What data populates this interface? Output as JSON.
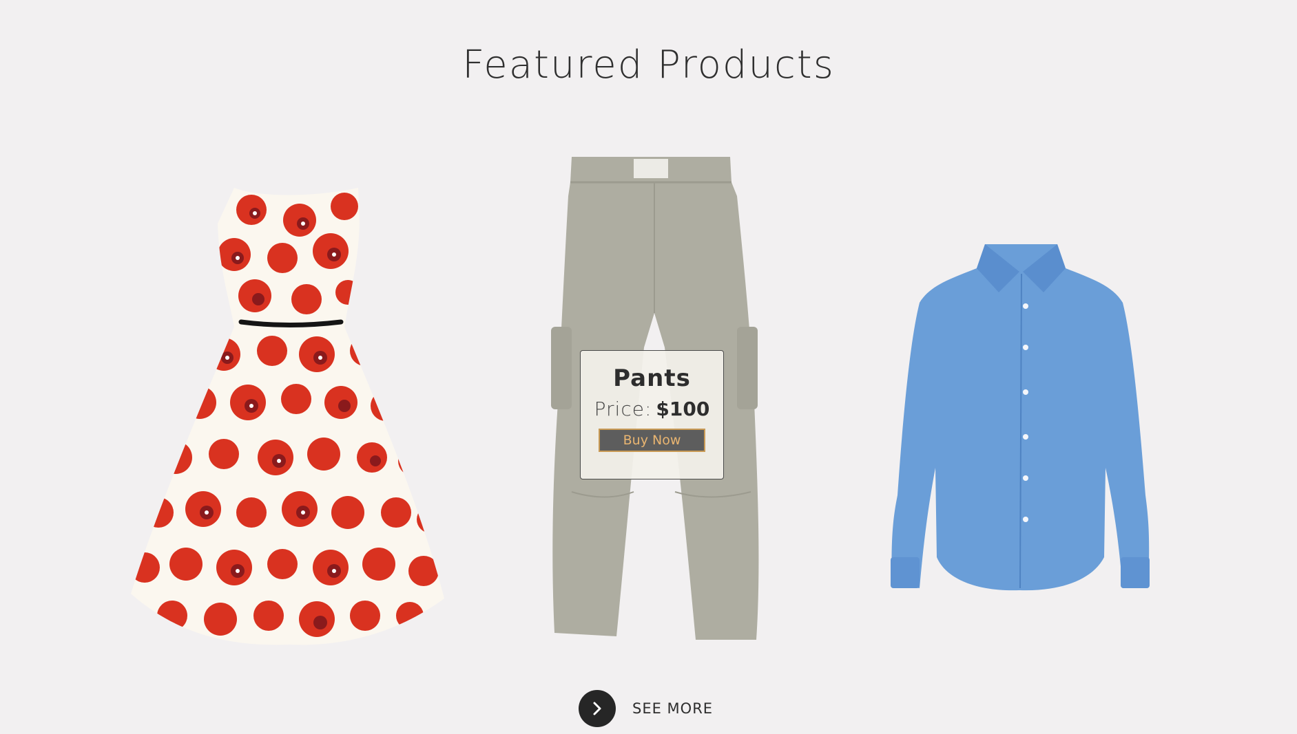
{
  "section": {
    "title": "Featured Products"
  },
  "products": [
    {
      "name": "Dress",
      "image": "red-poppy-floral-dress"
    },
    {
      "name": "Pants",
      "image": "grey-cargo-pants"
    },
    {
      "name": "Shirt",
      "image": "blue-button-down-shirt"
    }
  ],
  "hover_card": {
    "name": "Pants",
    "price_label": "Price:",
    "price_value": "$100",
    "button_label": "Buy Now"
  },
  "see_more": {
    "label": "SEE MORE",
    "icon": "chevron-right-icon"
  },
  "colors": {
    "background": "#f2f0f1",
    "button_bg": "#5d5d5d",
    "button_text": "#e9b571",
    "see_more_circle": "#262626"
  }
}
